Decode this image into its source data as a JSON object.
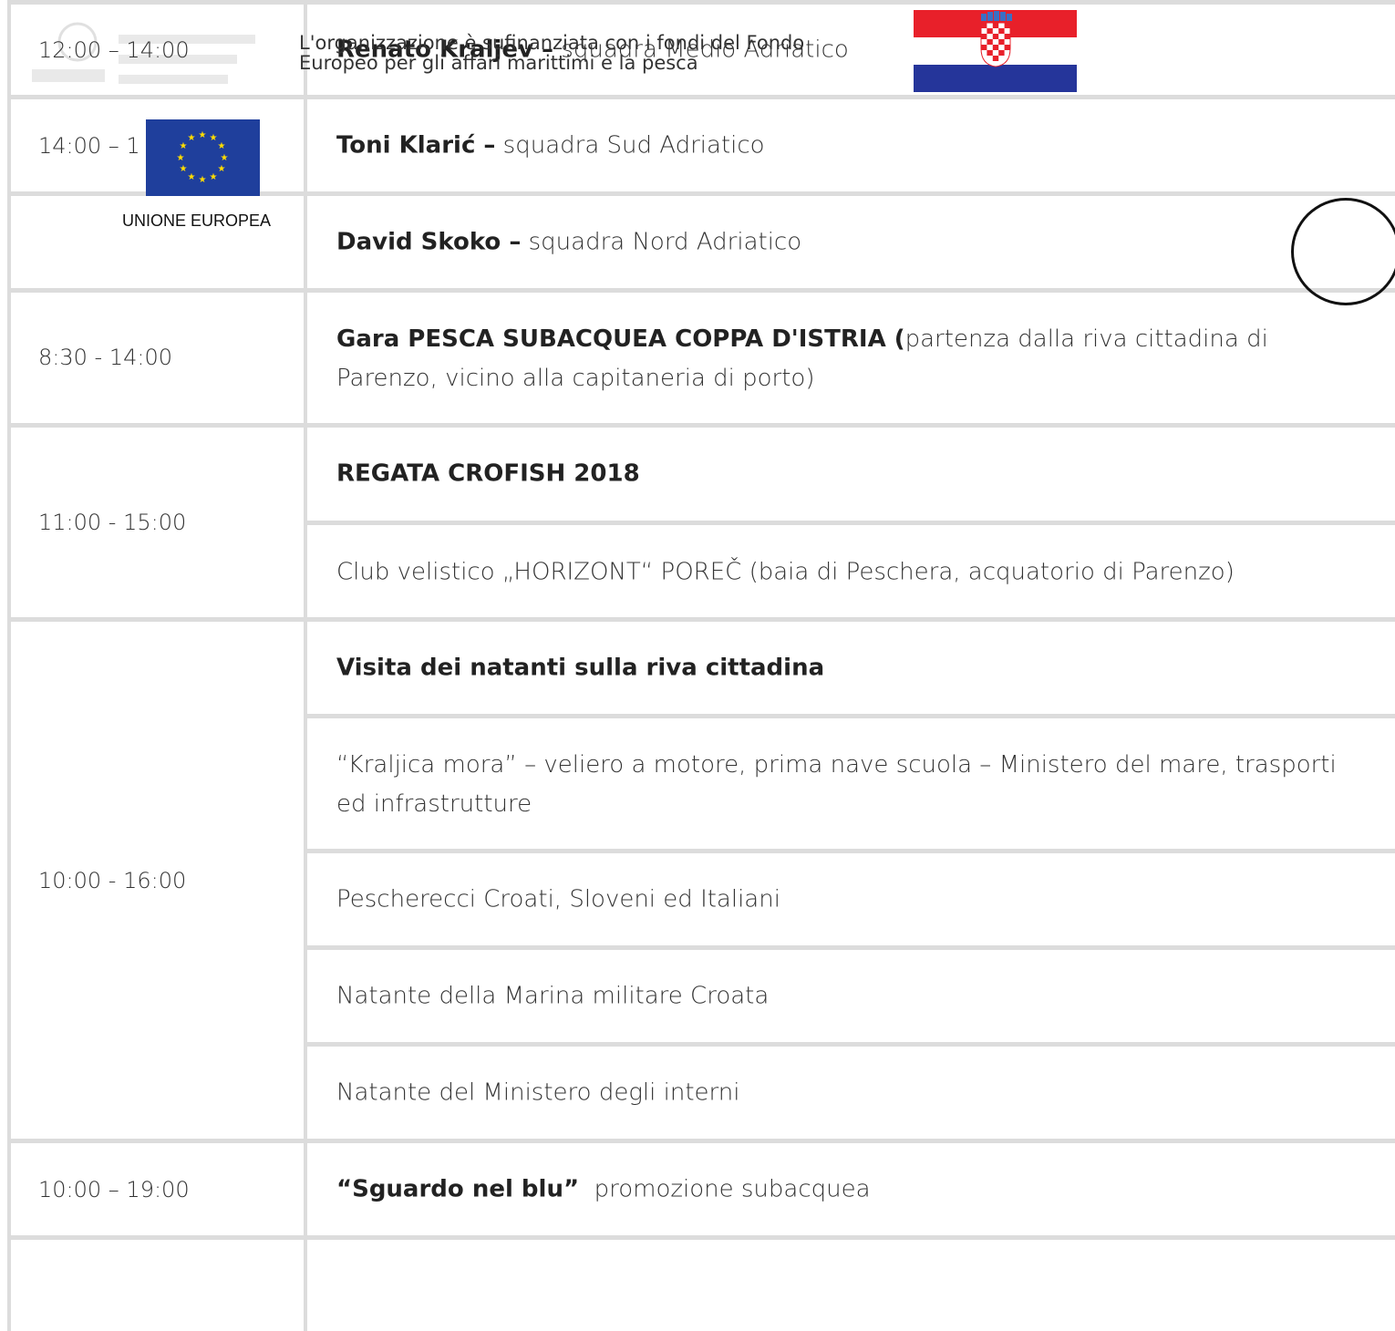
{
  "header": {
    "funding_note": "L'organizzazione è sufinanziata con i fondi del Fondo Europeo per gli affari marittimi e la pesca",
    "eu_label": "UNIONE EUROPEA"
  },
  "schedule": [
    {
      "time": "12:00 – 14:00",
      "bold": "Renato Kraljev –",
      "text": " squadra Medio Adriatico"
    },
    {
      "time": "14:00 – 1",
      "bold": "Toni Klarić –",
      "text": " squadra Sud Adriatico"
    },
    {
      "time": "",
      "bold": "David Skoko –",
      "text": " squadra Nord Adriatico"
    },
    {
      "time": "8:30 - 14:00",
      "bold": "Gara PESCA SUBACQUEA COPPA D'ISTRIA (",
      "text": "partenza dalla riva cittadina di Parenzo, vicino alla capitaneria di porto)"
    },
    {
      "time": "11:00 - 15:00",
      "rows": [
        {
          "bold": "REGATA CROFISH 2018",
          "text": ""
        },
        {
          "bold": "",
          "text": "Club velistico „HORIZONT“ POREČ (baia di Peschera, acquatorio di Parenzo)"
        }
      ]
    },
    {
      "time": "10:00 - 16:00",
      "rows": [
        {
          "bold": "Visita dei natanti sulla riva cittadina",
          "text": ""
        },
        {
          "bold": "",
          "text": "“Kraljica mora” – veliero a motore, prima nave scuola  – Ministero del mare, trasporti ed infrastrutture"
        },
        {
          "bold": "",
          "text": "Pescherecci Croati, Sloveni ed Italiani"
        },
        {
          "bold": "",
          "text": "Natante della Marina militare Croata"
        },
        {
          "bold": "",
          "text": "Natante del Ministero degli interni"
        }
      ]
    },
    {
      "time": "10:00 – 19:00",
      "bold": "“Sguardo nel blu”",
      "text": "  promozione subacquea"
    }
  ],
  "colors": {
    "grid": "#dcdcdc",
    "eu_blue": "#1f3f9c",
    "eu_star": "#ffdd00",
    "hr_red": "#e8202a",
    "hr_blue": "#25359a"
  },
  "icons": [
    "eu-flag-icon",
    "croatia-flag-icon",
    "ministry-logo-icon"
  ]
}
